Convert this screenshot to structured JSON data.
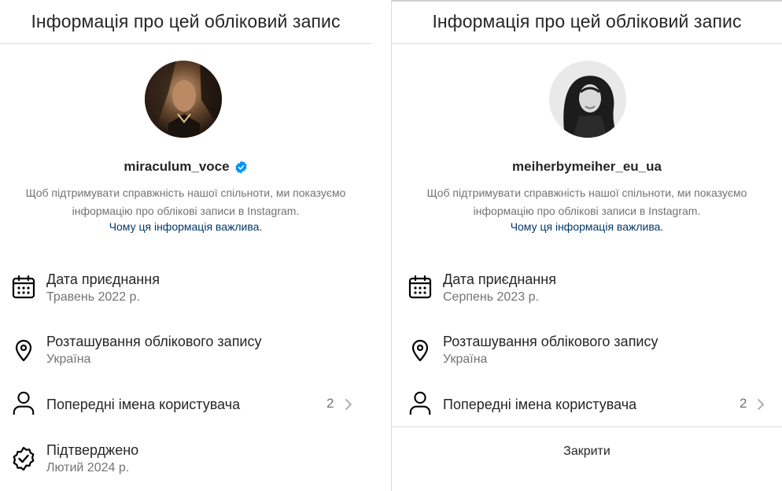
{
  "left": {
    "header_title": "Інформація про цей обліковий запис",
    "username": "miraculum_voce",
    "verified_badge": true,
    "description": "Щоб підтримувати справжність нашої спільноти, ми показуємо інформацію про облікові записи в Instagram.",
    "why_link": "Чому ця інформація важлива.",
    "join_label": "Дата приєднання",
    "join_value": "Травень 2022 р.",
    "location_label": "Розташування облікового запису",
    "location_value": "Україна",
    "prev_names_label": "Попередні імена користувача",
    "prev_names_count": "2",
    "verified_label": "Підтверджено",
    "verified_value": "Лютий 2024 р."
  },
  "right": {
    "header_title": "Інформація про цей обліковий запис",
    "username": "meiherbymeiher_eu_ua",
    "description": "Щоб підтримувати справжність нашої спільноти, ми показуємо інформацію про облікові записи в Instagram.",
    "why_link": "Чому ця інформація важлива.",
    "join_label": "Дата приєднання",
    "join_value": "Серпень 2023 р.",
    "location_label": "Розташування облікового запису",
    "location_value": "Україна",
    "prev_names_label": "Попередні імена користувача",
    "prev_names_count": "2",
    "close_label": "Закрити"
  },
  "colors": {
    "link": "#00376b",
    "secondary_text": "#737373",
    "verified_blue": "#0095f6",
    "divider": "#dbdbdb"
  },
  "icons": [
    "calendar-icon",
    "location-pin-icon",
    "person-icon",
    "verified-seal-icon",
    "chevron-right-icon",
    "verified-badge-icon"
  ]
}
